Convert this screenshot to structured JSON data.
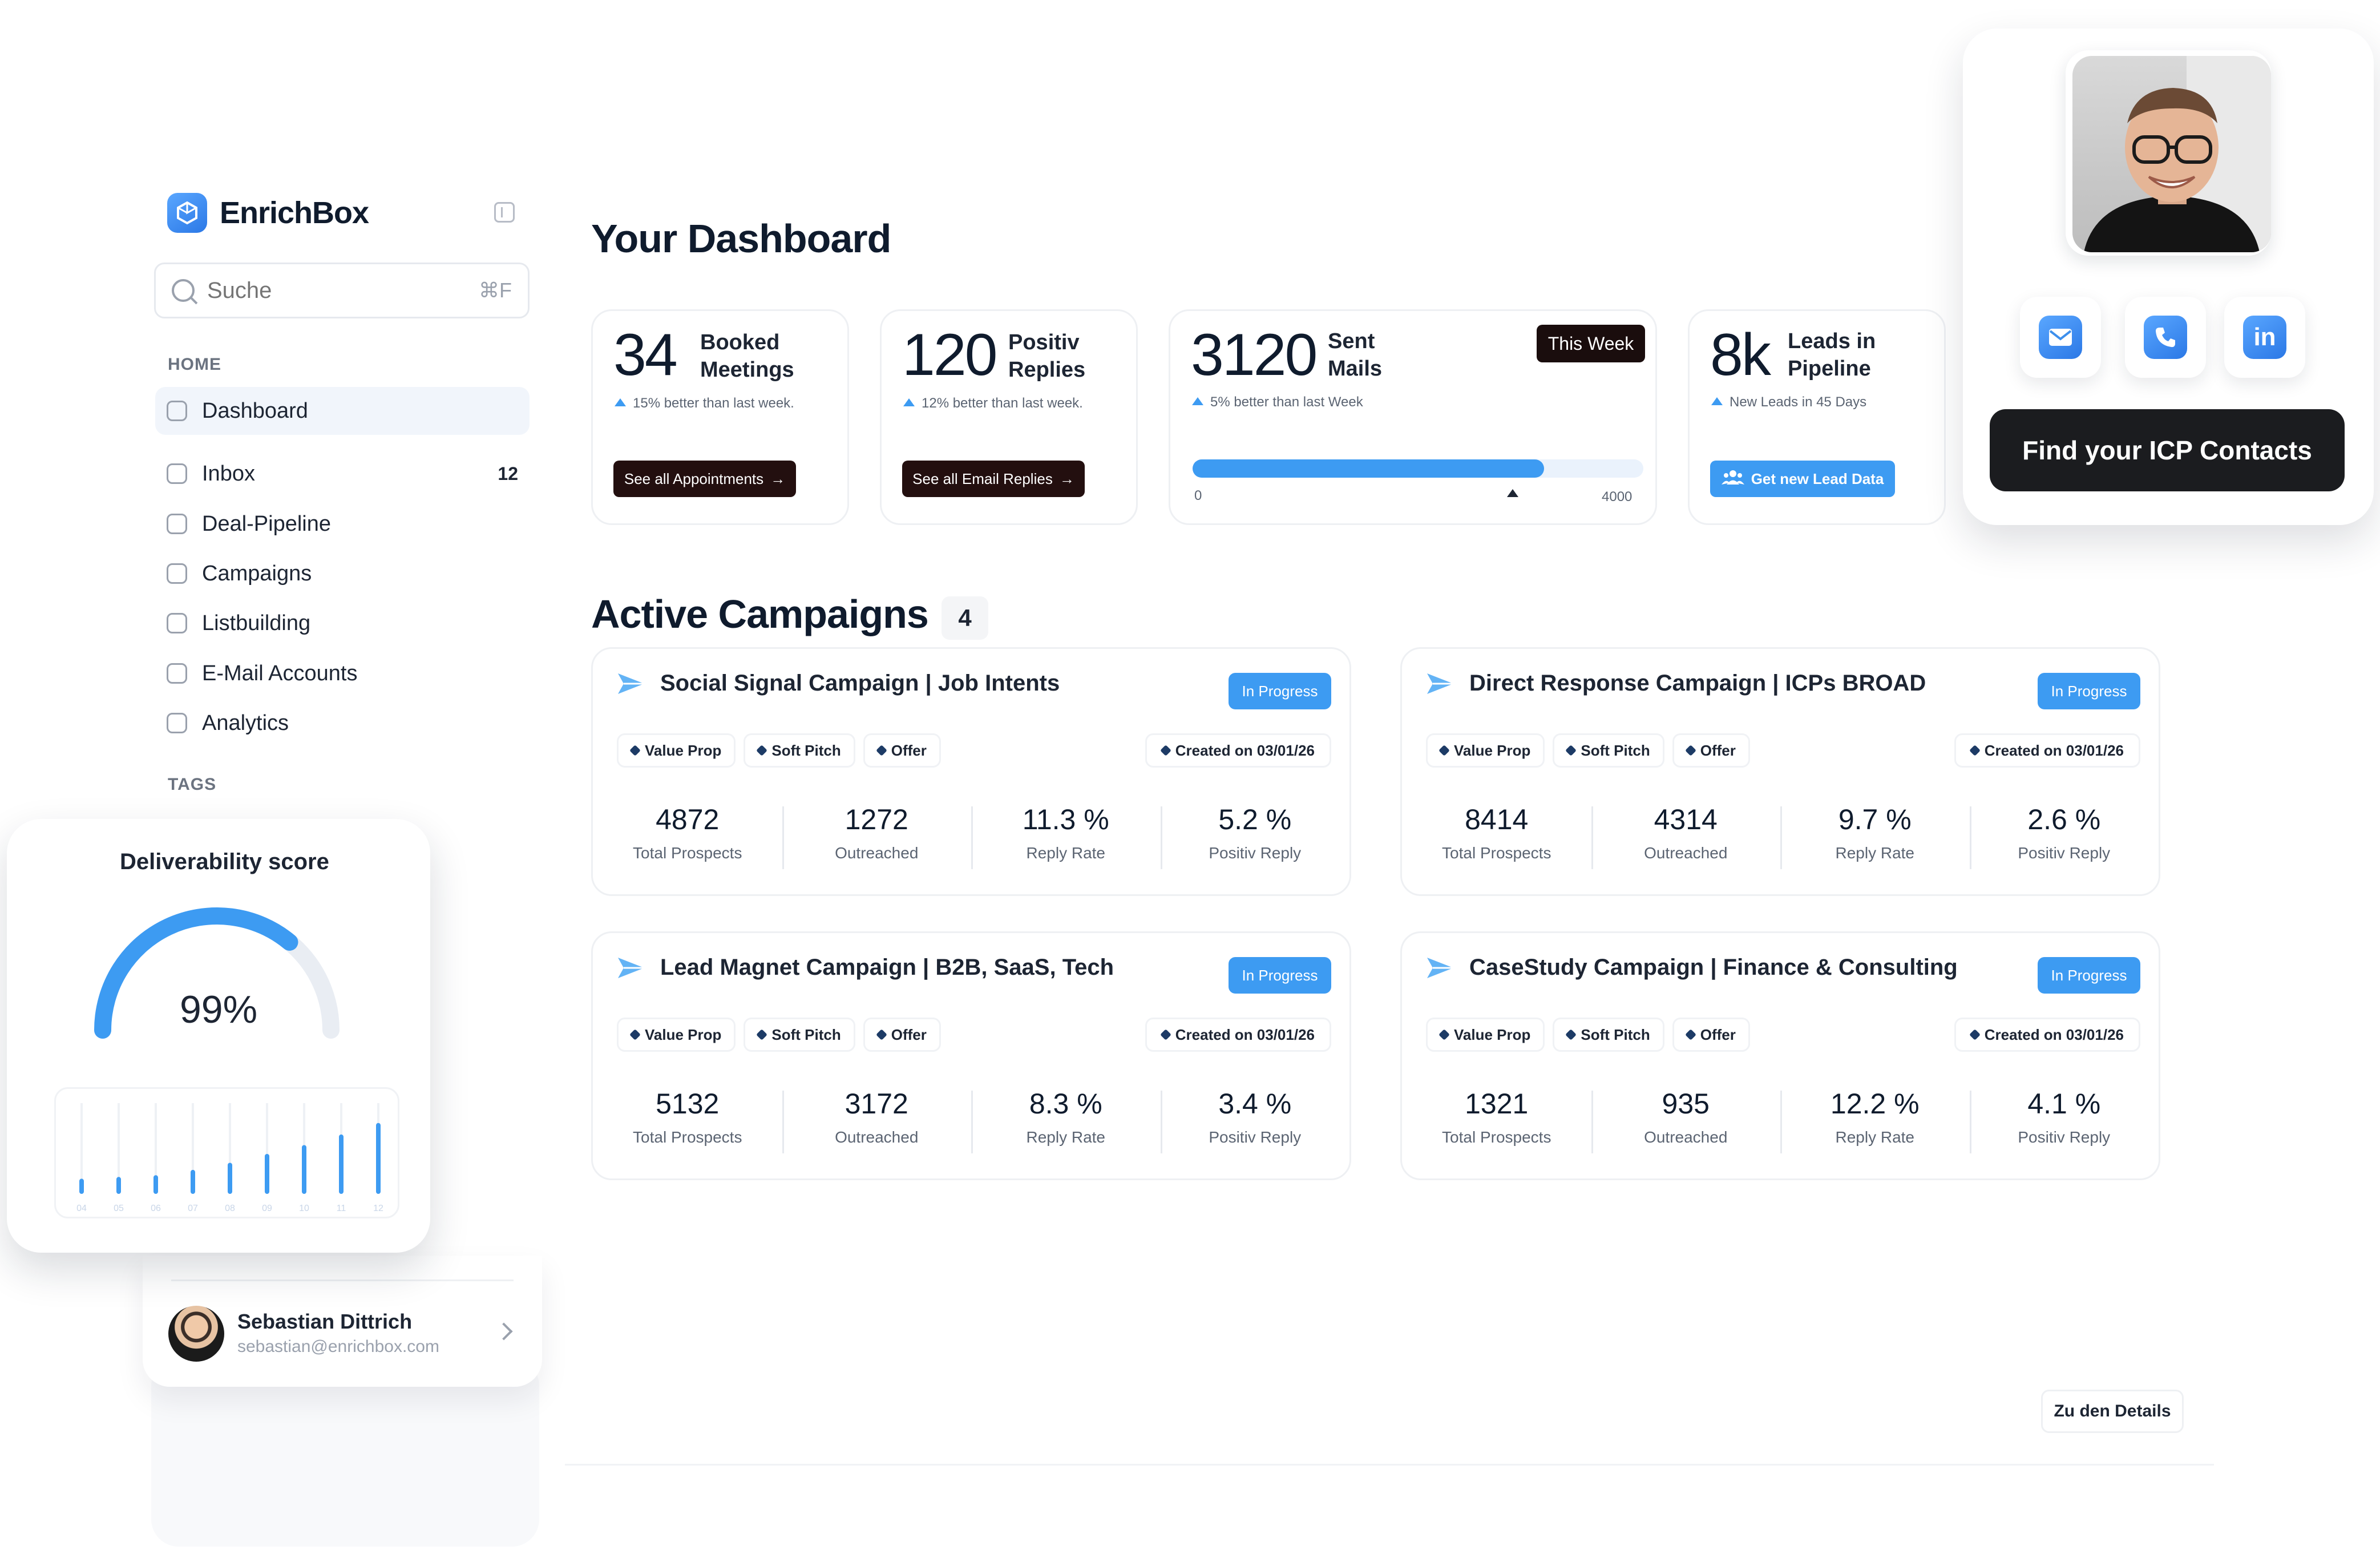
{
  "sidebar": {
    "brand": "EnrichBox",
    "search": {
      "placeholder": "Suche",
      "shortcut": "⌘F"
    },
    "section_home": "HOME",
    "section_tags": "TAGS",
    "items": [
      {
        "label": "Dashboard",
        "icon": "home-icon",
        "active": true
      },
      {
        "label": "Inbox",
        "icon": "inbox-icon",
        "badge": "12"
      },
      {
        "label": "Deal-Pipeline",
        "icon": "check-square-icon"
      },
      {
        "label": "Campaigns",
        "icon": "send-icon"
      },
      {
        "label": "Listbuilding",
        "icon": "list-icon"
      },
      {
        "label": "E-Mail Accounts",
        "icon": "accounts-icon"
      },
      {
        "label": "Analytics",
        "icon": "analytics-icon"
      }
    ],
    "profile": {
      "name": "Sebastian Dittrich",
      "email": "sebastian@enrichbox.com"
    }
  },
  "deliverability": {
    "title": "Deliverability score",
    "value": "99%",
    "gauge_fraction": 0.72,
    "bars": [
      {
        "label": "04",
        "level": 0.12
      },
      {
        "label": "05",
        "level": 0.14
      },
      {
        "label": "06",
        "level": 0.16
      },
      {
        "label": "07",
        "level": 0.22
      },
      {
        "label": "08",
        "level": 0.3
      },
      {
        "label": "09",
        "level": 0.4
      },
      {
        "label": "10",
        "level": 0.5
      },
      {
        "label": "11",
        "level": 0.62
      },
      {
        "label": "12",
        "level": 0.75
      }
    ]
  },
  "main": {
    "title": "Your Dashboard",
    "stats": [
      {
        "value": "34",
        "label_line1": "Booked",
        "label_line2": "Meetings",
        "sub": "15% better than last week.",
        "button": "See all Appointments"
      },
      {
        "value": "120",
        "label_line1": "Positiv",
        "label_line2": "Replies",
        "sub": "12% better than last week.",
        "button": "See all Email Replies"
      },
      {
        "value": "3120",
        "label_line1": "Sent",
        "label_line2": "Mails",
        "sub": "5% better than last Week",
        "badge": "This Week",
        "progress_min": "0",
        "progress_max": "4000",
        "progress_fraction": 0.78
      },
      {
        "value": "8k",
        "label_line1": "Leads in",
        "label_line2": "Pipeline",
        "sub": "New Leads in 45 Days",
        "button": "Get new Lead Data"
      }
    ],
    "campaigns_title": "Active Campaigns",
    "campaigns_count": "4",
    "campaigns": [
      {
        "name": "Social Signal Campaign | Job Intents",
        "status": "In Progress",
        "tags": [
          "Value Prop",
          "Soft Pitch",
          "Offer"
        ],
        "created": "Created on 03/01/26",
        "metrics": [
          {
            "value": "4872",
            "label": "Total Prospects"
          },
          {
            "value": "1272",
            "label": "Outreached"
          },
          {
            "value": "11.3 %",
            "label": "Reply Rate"
          },
          {
            "value": "5.2 %",
            "label": "Positiv Reply"
          }
        ]
      },
      {
        "name": "Direct Response Campaign | ICPs BROAD",
        "status": "In Progress",
        "tags": [
          "Value Prop",
          "Soft Pitch",
          "Offer"
        ],
        "created": "Created on 03/01/26",
        "metrics": [
          {
            "value": "8414",
            "label": "Total Prospects"
          },
          {
            "value": "4314",
            "label": "Outreached"
          },
          {
            "value": "9.7 %",
            "label": "Reply Rate"
          },
          {
            "value": "2.6 %",
            "label": "Positiv Reply"
          }
        ]
      },
      {
        "name": "Lead Magnet Campaign | B2B, SaaS, Tech",
        "status": "In Progress",
        "tags": [
          "Value Prop",
          "Soft Pitch",
          "Offer"
        ],
        "created": "Created on 03/01/26",
        "metrics": [
          {
            "value": "5132",
            "label": "Total Prospects"
          },
          {
            "value": "3172",
            "label": "Outreached"
          },
          {
            "value": "8.3 %",
            "label": "Reply Rate"
          },
          {
            "value": "3.4 %",
            "label": "Positiv Reply"
          }
        ]
      },
      {
        "name": "CaseStudy Campaign | Finance & Consulting",
        "status": "In Progress",
        "tags": [
          "Value Prop",
          "Soft Pitch",
          "Offer"
        ],
        "created": "Created on 03/01/26",
        "metrics": [
          {
            "value": "1321",
            "label": "Total Prospects"
          },
          {
            "value": "935",
            "label": "Outreached"
          },
          {
            "value": "12.2 %",
            "label": "Reply Rate"
          },
          {
            "value": "4.1 %",
            "label": "Positiv Reply"
          }
        ]
      }
    ],
    "details_button": "Zu den Details"
  },
  "contact": {
    "icons": [
      "mail-icon",
      "phone-icon",
      "linkedin-icon"
    ],
    "linkedin_text": "in",
    "cta": "Find your ICP Contacts"
  },
  "colors": {
    "accent": "#3d9bf2",
    "dark": "#1b1c1f",
    "text": "#0f1b2d"
  }
}
